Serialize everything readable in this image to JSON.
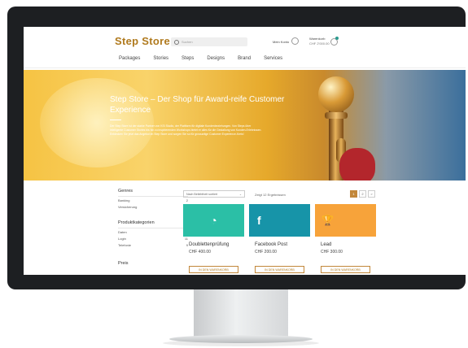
{
  "header": {
    "logo": "Step Store",
    "search_placeholder": "Suchen",
    "account_label": "Mein Konto",
    "cart_label": "Warenkorb",
    "cart_total": "CHF 2'000.00",
    "cart_count": "0"
  },
  "nav": [
    "Packages",
    "Stories",
    "Steps",
    "Designs",
    "Brand",
    "Services"
  ],
  "hero": {
    "title": "Step Store – Der Shop für Award-reife Customer Experience",
    "body": "Der Step Store ist der starke Partner von KSI Studio, der Plattform für digitale Kundenbeziehungen. Von Steps über intelligente Customer Stories bis hin zu inspirierenden Workshops bietet er alles für die Gestaltung von Kunden-Erlebnissen. Entdecken Sie jetzt das Angebot im Step Store und sorgen Sie so für grossartige Customer Experience-Kreis!"
  },
  "sidebar": {
    "genres_title": "Genres",
    "genres": [
      {
        "label": "Banking",
        "count": "2"
      },
      {
        "label": "Versicherung",
        "count": "2"
      }
    ],
    "categories_title": "Produktkategorien",
    "categories": [
      {
        "label": "Daten",
        "count": "12"
      },
      {
        "label": "Login",
        "count": "11"
      },
      {
        "label": "Telefonie",
        "count": "9"
      }
    ],
    "price_title": "Preis"
  },
  "toolbar": {
    "sort_label": "Nach Beliebtheit sortiert",
    "results": "Zeigt 12 Ergebnissen",
    "pages": [
      "1",
      "2",
      ">"
    ]
  },
  "products": [
    {
      "name": "Doublettenprüfung",
      "price": "CHF 400.00",
      "button": "IN DEN WARENKORB",
      "color": "#2bbfa6",
      "icon": "timer-icon",
      "glyph": "◔"
    },
    {
      "name": "Facebook Post",
      "price": "CHF 200.00",
      "button": "IN DEN WARENKORB",
      "color": "#1794a8",
      "icon": "facebook-icon",
      "glyph": "f"
    },
    {
      "name": "Lead",
      "price": "CHF 300.00",
      "button": "IN DEN WARENKORB",
      "color": "#f7a33a",
      "icon": "trophy-icon",
      "glyph": "🏆"
    }
  ],
  "colors": {
    "brand": "#b07a1e",
    "accent": "#c2873a"
  }
}
